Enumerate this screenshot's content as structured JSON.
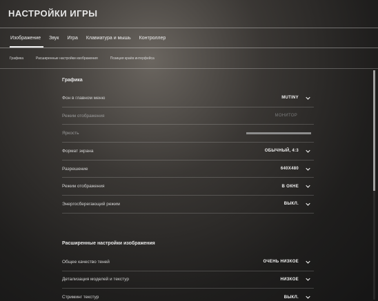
{
  "window": {
    "title": "НАСТРОЙКИ ИГРЫ"
  },
  "main_tabs": [
    {
      "label": "Изображение",
      "active": true
    },
    {
      "label": "Звук"
    },
    {
      "label": "Игра"
    },
    {
      "label": "Клавиатура и мышь"
    },
    {
      "label": "Контроллер"
    }
  ],
  "sub_tabs": [
    {
      "label": "Графика"
    },
    {
      "label": "Расширенные настройки изображения"
    },
    {
      "label": "Позиция краёв интерфейса"
    }
  ],
  "sections": {
    "graphics": {
      "title": "Графика",
      "rows": {
        "menu_background": {
          "label": "Фон в главном меню",
          "value": "MUTINY"
        },
        "display_mode_monitor": {
          "label": "Режим отображения",
          "value": "МОНИТОР"
        },
        "brightness": {
          "label": "Яркость",
          "level": 0.5
        },
        "aspect_ratio": {
          "label": "Формат экрана",
          "value": "ОБЫЧНЫЙ, 4:3"
        },
        "resolution": {
          "label": "Разрешение",
          "value": "640X480"
        },
        "display_mode": {
          "label": "Режим отображения",
          "value": "В ОКНЕ"
        },
        "power_saving": {
          "label": "Энергосберегающий режим",
          "value": "ВЫКЛ."
        }
      }
    },
    "advanced": {
      "title": "Расширенные настройки изображения",
      "rows": {
        "shadow_quality": {
          "label": "Общее качество теней",
          "value": "ОЧЕНЬ НИЗКОЕ"
        },
        "model_detail": {
          "label": "Детализация моделей и текстур",
          "value": "НИЗКОЕ"
        },
        "texture_streaming": {
          "label": "Стриминг текстур",
          "value": "ВЫКЛ."
        }
      }
    }
  },
  "icons": {
    "dropdown": "chevron-down-icon"
  },
  "colors": {
    "background": "#2a2826",
    "text": "#e8e8e8",
    "divider": "#5a5856"
  }
}
